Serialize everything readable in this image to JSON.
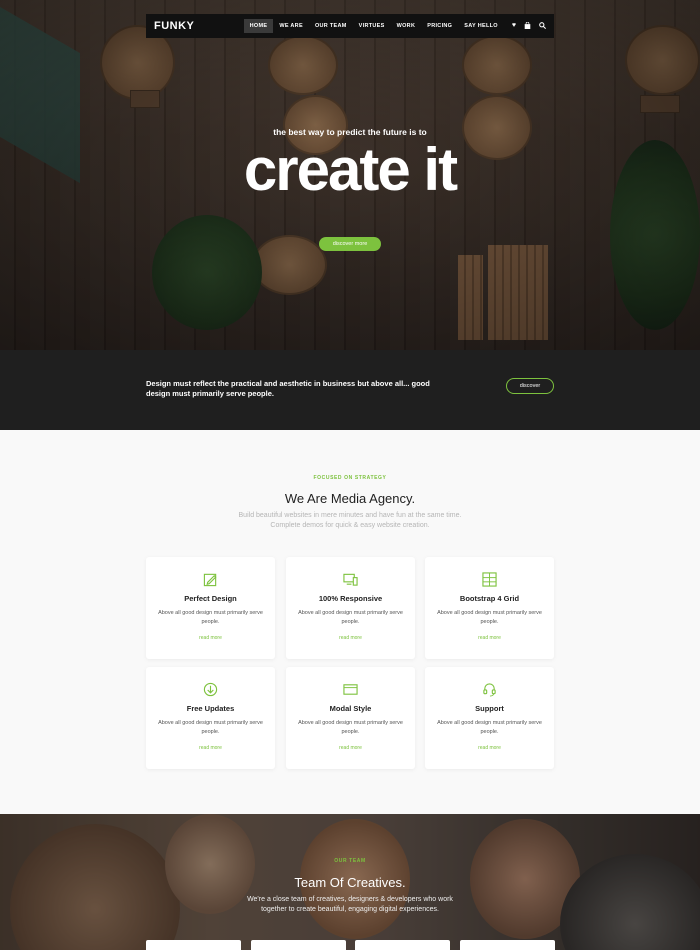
{
  "nav": {
    "logo": "FUNKY",
    "items": [
      {
        "label": "HOME",
        "active": true
      },
      {
        "label": "WE ARE"
      },
      {
        "label": "OUR TEAM"
      },
      {
        "label": "VIRTUES"
      },
      {
        "label": "WORK"
      },
      {
        "label": "PRICING"
      },
      {
        "label": "SAY HELLO"
      }
    ],
    "icons": [
      "heart-icon",
      "bag-icon",
      "search-icon"
    ]
  },
  "hero": {
    "subtitle": "the best way to predict the future is to",
    "title": "create it",
    "button": "discover more"
  },
  "band": {
    "text": "Design must reflect the practical and aesthetic in business but above all... good design must primarily serve people.",
    "button": "discover"
  },
  "services": {
    "eyebrow": "FOCUSED ON STRATEGY",
    "title": "We Are Media Agency.",
    "description_line1": "Build beautiful websites in mere minutes and have fun at the same time.",
    "description_line2": "Complete demos for quick & easy website creation.",
    "cards": [
      {
        "icon": "pencil-icon",
        "title": "Perfect Design",
        "text": "Above all good design must primarily serve people.",
        "link": "read more"
      },
      {
        "icon": "devices-icon",
        "title": "100% Responsive",
        "text": "Above all good design must primarily serve people.",
        "link": "read more"
      },
      {
        "icon": "grid-icon",
        "title": "Bootstrap 4 Grid",
        "text": "Above all good design must primarily serve people.",
        "link": "read more"
      },
      {
        "icon": "download-icon",
        "title": "Free Updates",
        "text": "Above all good design must primarily serve people.",
        "link": "read more"
      },
      {
        "icon": "window-icon",
        "title": "Modal Style",
        "text": "Above all good design must primarily serve people.",
        "link": "read more"
      },
      {
        "icon": "headset-icon",
        "title": "Support",
        "text": "Above all good design must primarily serve people.",
        "link": "read more"
      }
    ]
  },
  "team": {
    "eyebrow": "OUR TEAM",
    "title": "Team Of Creatives.",
    "description_line1": "We're a close team of creatives, designers & developers who work",
    "description_line2": "together to create beautiful, engaging digital experiences."
  },
  "colors": {
    "accent": "#7dc23e",
    "dark": "#1f1f1f",
    "nav": "#111111"
  }
}
